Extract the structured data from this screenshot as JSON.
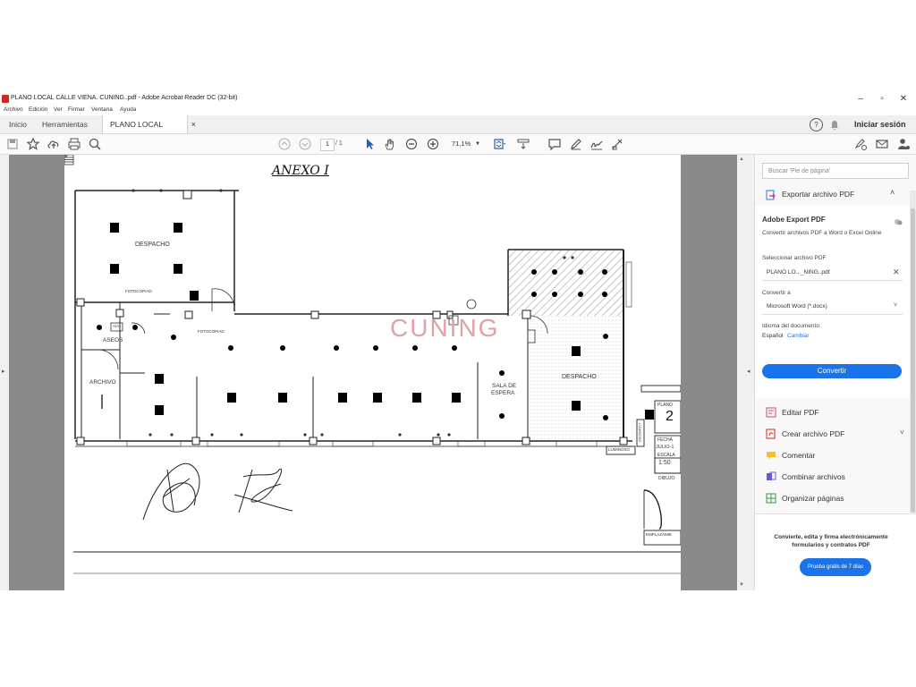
{
  "window": {
    "title": "PLANO LOCAL CALLE VIENA. CUNING..pdf - Adobe Acrobat Reader DC (32-bit)"
  },
  "menu": [
    "Archivo",
    "Edición",
    "Ver",
    "Firmar",
    "Ventana",
    "Ayuda"
  ],
  "tabs": {
    "home": "Inicio",
    "tools": "Herramientas",
    "document": "PLANO LOCAL CA...",
    "close": "×"
  },
  "header": {
    "help": "?",
    "signin": "Iniciar sesión"
  },
  "toolbar": {
    "page_current": "1",
    "page_total": "/ 1",
    "zoom": "71,1%"
  },
  "document": {
    "annex_title": "ANEXO I",
    "watermark": "CUNING",
    "rooms": {
      "despacho_1": "DESPACHO",
      "despacho_2": "DESPACHO",
      "aseos": "ASEOS",
      "archivo": "ARCHIVO",
      "sala_espera_1": "SALA DE",
      "sala_espera_2": "ESPERA"
    },
    "labels": {
      "fotocopiad_1": "FOTOCOPIAD.",
      "fotocopiad_2": "FOTOCOPIAD.",
      "aa": "A/A",
      "luminoso_1": "LUMINOSO",
      "luminoso_2": "LUMINOSO",
      "plano": "PLANO",
      "plano_num": "2",
      "fecha": "FECHA",
      "fecha_val": "JULIO-1",
      "escala": "ESCALA",
      "escala_val": "1:50",
      "dibujo": "DIBUJO",
      "emplazam": "EMPLAZAMIE"
    }
  },
  "right_panel": {
    "search_placeholder": "Buscar 'Pie de página'",
    "export_header": "Exportar archivo PDF",
    "export_title": "Adobe Export PDF",
    "export_desc": "Convertir archivos PDF a Word o Excel Online",
    "select_label": "Seleccionar archivo PDF",
    "selected_file": "PLANO LO..._NING..pdf",
    "convert_to_label": "Convertir a",
    "convert_to_value": "Microsoft Word (*.docx)",
    "doc_language_label": "Idioma del documento:",
    "doc_language_value": "Español",
    "change_link": "Cambiar",
    "convert_button": "Convertir",
    "tools": [
      "Editar PDF",
      "Crear archivo PDF",
      "Comentar",
      "Combinar archivos",
      "Organizar páginas"
    ],
    "promo_line1": "Convierte, edita y firma electrónicamente",
    "promo_line2": "formularios y contratos PDF",
    "trial_button": "Prueba gratis de 7 días"
  },
  "colors": {
    "accent_blue": "#1a73e8",
    "acrobat_red": "#d4271b",
    "watermark": "#e2a0a7"
  }
}
